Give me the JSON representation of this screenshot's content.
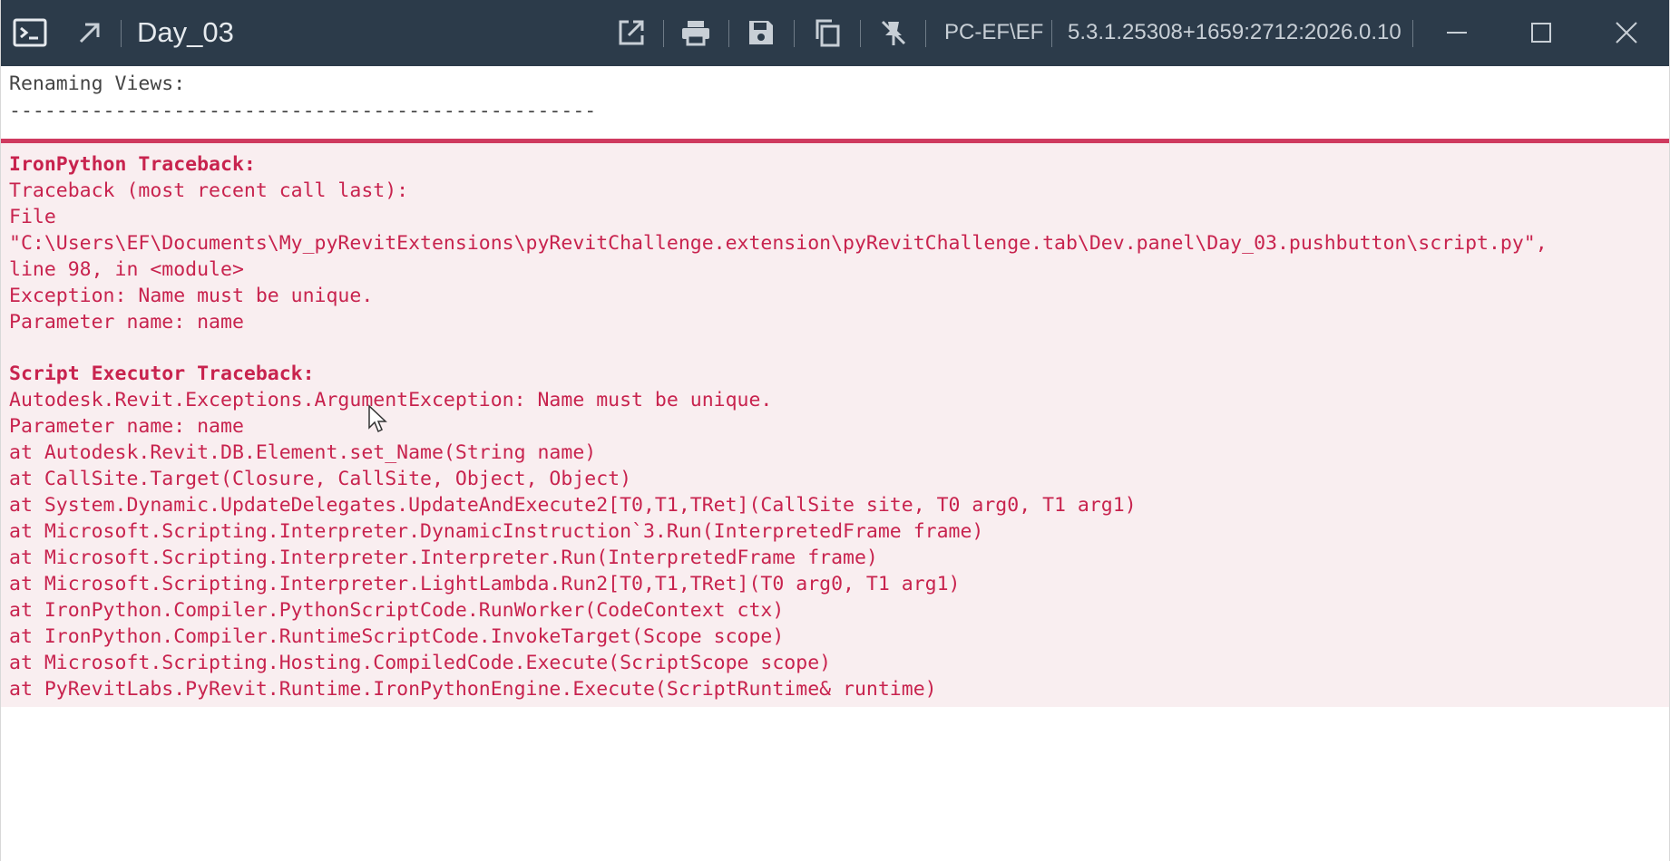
{
  "window": {
    "title": "Day_03",
    "machine": "PC-EF\\EF",
    "version": "5.3.1.25308+1659:2712:2026.0.10"
  },
  "titlebar_icons": {
    "app": "console-icon",
    "pin": "arrow-up-right-icon",
    "open_external": "open-external-icon",
    "print": "printer-icon",
    "save": "save-icon",
    "copy": "copy-icon",
    "debug": "debug-off-icon",
    "minimize": "minimize-icon",
    "maximize": "maximize-icon",
    "close": "close-icon"
  },
  "output": {
    "heading": "Renaming Views:",
    "divider": "--------------------------------------------------"
  },
  "error": {
    "ironpython_title": "IronPython Traceback:",
    "ironpython_lines": [
      "Traceback (most recent call last):",
      "File",
      "\"C:\\Users\\EF\\Documents\\My_pyRevitExtensions\\pyRevitChallenge.extension\\pyRevitChallenge.tab\\Dev.panel\\Day_03.pushbutton\\script.py\",",
      "line 98, in <module>",
      "Exception: Name must be unique.",
      "Parameter name: name"
    ],
    "executor_title": "Script Executor Traceback:",
    "executor_lines": [
      "Autodesk.Revit.Exceptions.ArgumentException: Name must be unique.",
      "Parameter name: name",
      "at Autodesk.Revit.DB.Element.set_Name(String name)",
      "at CallSite.Target(Closure, CallSite, Object, Object)",
      "at System.Dynamic.UpdateDelegates.UpdateAndExecute2[T0,T1,TRet](CallSite site, T0 arg0, T1 arg1)",
      "at Microsoft.Scripting.Interpreter.DynamicInstruction`3.Run(InterpretedFrame frame)",
      "at Microsoft.Scripting.Interpreter.Interpreter.Run(InterpretedFrame frame)",
      "at Microsoft.Scripting.Interpreter.LightLambda.Run2[T0,T1,TRet](T0 arg0, T1 arg1)",
      "at IronPython.Compiler.PythonScriptCode.RunWorker(CodeContext ctx)",
      "at IronPython.Compiler.RuntimeScriptCode.InvokeTarget(Scope scope)",
      "at Microsoft.Scripting.Hosting.CompiledCode.Execute(ScriptScope scope)",
      "at PyRevitLabs.PyRevit.Runtime.IronPythonEngine.Execute(ScriptRuntime& runtime)"
    ]
  },
  "colors": {
    "titlebar": "#2c3b4a",
    "error_text": "#c8234e",
    "error_bg": "#f9eef0",
    "error_border": "#cf3a5f"
  }
}
